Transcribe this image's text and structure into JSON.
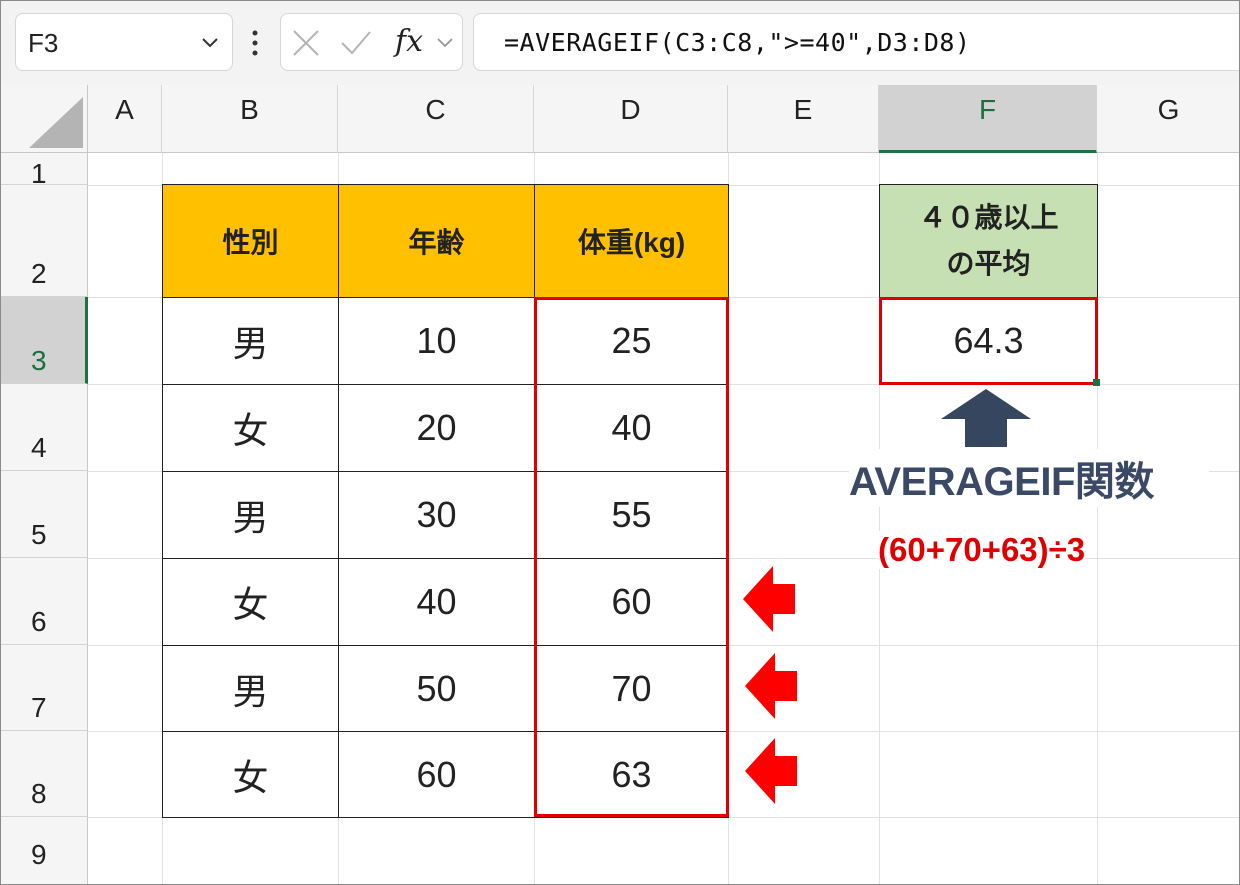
{
  "formula_bar": {
    "name_box": "F3",
    "fx_label": "fx",
    "formula": "=AVERAGEIF(C3:C8,\">=40\",D3:D8)"
  },
  "columns": [
    "A",
    "B",
    "C",
    "D",
    "E",
    "F",
    "G"
  ],
  "rows": [
    "1",
    "2",
    "3",
    "4",
    "5",
    "6",
    "7",
    "8",
    "9"
  ],
  "selected_cell": "F3",
  "table": {
    "headers": [
      "性別",
      "年齢",
      "体重(kg)"
    ],
    "rows": [
      [
        "男",
        "10",
        "25"
      ],
      [
        "女",
        "20",
        "40"
      ],
      [
        "男",
        "30",
        "55"
      ],
      [
        "女",
        "40",
        "60"
      ],
      [
        "男",
        "50",
        "70"
      ],
      [
        "女",
        "60",
        "63"
      ]
    ]
  },
  "result": {
    "header_line1": "４０歳以上",
    "header_line2": "の平均",
    "value": "64.3"
  },
  "annotation": {
    "function_label": "AVERAGEIF関数",
    "calculation": "(60+70+63)÷3"
  },
  "colors": {
    "header_fill": "#ffc000",
    "result_header_fill": "#c6e0b4",
    "highlight_red": "#e00000",
    "arrow_navy": "#36465e",
    "excel_green": "#1e7145"
  },
  "icons": [
    "chevron-down-icon",
    "more-vertical-icon",
    "cancel-icon",
    "enter-icon",
    "function-icon",
    "select-all-triangle-icon",
    "arrow-up-icon",
    "arrow-left-icon"
  ]
}
